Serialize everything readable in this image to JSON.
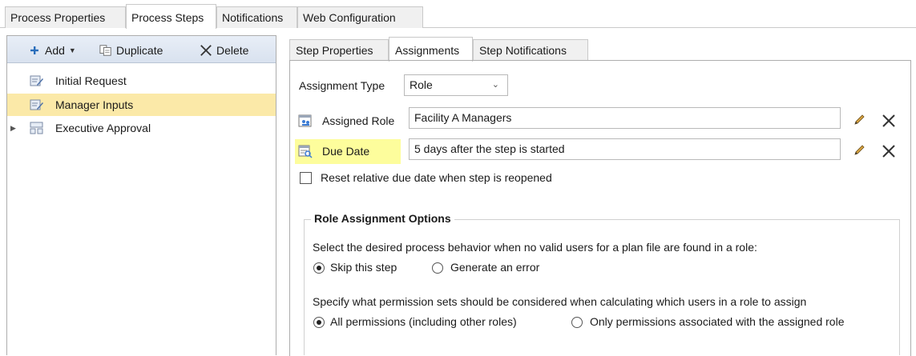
{
  "top_tabs": [
    "Process Properties",
    "Process Steps",
    "Notifications",
    "Web Configuration"
  ],
  "toolbar": {
    "add": "Add",
    "duplicate": "Duplicate",
    "delete": "Delete"
  },
  "tree": [
    {
      "label": "Initial Request"
    },
    {
      "label": "Manager Inputs"
    },
    {
      "label": "Executive Approval"
    }
  ],
  "right_tabs": [
    "Step Properties",
    "Assignments",
    "Step Notifications"
  ],
  "assignment": {
    "type_label": "Assignment Type",
    "type_value": "Role",
    "role_label": "Assigned Role",
    "role_value": "Facility A Managers",
    "due_label": "Due Date",
    "due_value": "5 days after the step is started",
    "reset_label": "Reset relative due date when step is reopened"
  },
  "options": {
    "title": "Role Assignment Options",
    "q1": "Select the desired process behavior when no valid users for a plan file are found in a role:",
    "q1_a": "Skip this step",
    "q1_b": "Generate an error",
    "q2": "Specify what permission sets should be considered when calculating which users in a role to assign",
    "q2_a": "All permissions (including other roles)",
    "q2_b": "Only permissions associated with the assigned role"
  },
  "colors": {
    "selection": "#fbe9a8",
    "highlight": "#fdfd9c",
    "add_icon": "#2a6ebb"
  }
}
